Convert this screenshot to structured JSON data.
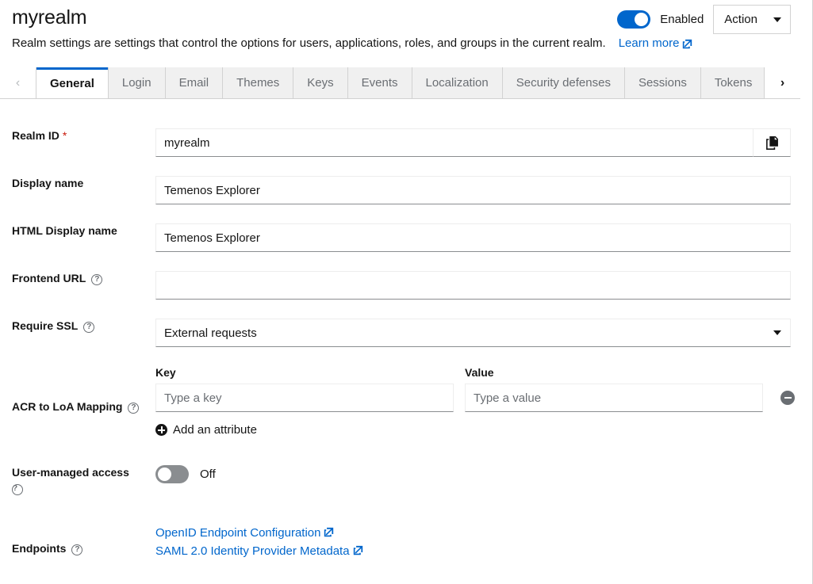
{
  "header": {
    "title": "myrealm",
    "subtitle": "Realm settings are settings that control the options for users, applications, roles, and groups in the current realm.",
    "learn_more": "Learn more",
    "enabled_toggle": {
      "label": "Enabled",
      "state": "on"
    },
    "action_button": "Action",
    "accent_color": "#0066cc"
  },
  "tabs": {
    "scroll_left": "‹",
    "scroll_right": "›",
    "items": [
      {
        "label": "General",
        "active": true
      },
      {
        "label": "Login",
        "active": false
      },
      {
        "label": "Email",
        "active": false
      },
      {
        "label": "Themes",
        "active": false
      },
      {
        "label": "Keys",
        "active": false
      },
      {
        "label": "Events",
        "active": false
      },
      {
        "label": "Localization",
        "active": false
      },
      {
        "label": "Security defenses",
        "active": false
      },
      {
        "label": "Sessions",
        "active": false
      },
      {
        "label": "Tokens",
        "active": false
      }
    ]
  },
  "form": {
    "realm_id": {
      "label": "Realm ID",
      "required_marker": "*",
      "value": "myrealm"
    },
    "display_name": {
      "label": "Display name",
      "value": "Temenos Explorer"
    },
    "html_display_name": {
      "label": "HTML Display name",
      "value": "Temenos Explorer"
    },
    "frontend_url": {
      "label": "Frontend URL",
      "value": "",
      "help": "?"
    },
    "require_ssl": {
      "label": "Require SSL",
      "value": "External requests",
      "help": "?"
    },
    "acr_to_loa": {
      "label": "ACR to LoA Mapping",
      "help": "?",
      "key_header": "Key",
      "value_header": "Value",
      "key_placeholder": "Type a key",
      "value_placeholder": "Type a value",
      "key_value": "",
      "value_value": "",
      "add_attribute": "Add an attribute"
    },
    "user_managed_access": {
      "label": "User-managed access",
      "help": "?",
      "state_label": "Off",
      "state": "off"
    },
    "endpoints": {
      "label": "Endpoints",
      "help": "?",
      "links": [
        "OpenID Endpoint Configuration",
        "SAML 2.0 Identity Provider Metadata"
      ]
    }
  }
}
